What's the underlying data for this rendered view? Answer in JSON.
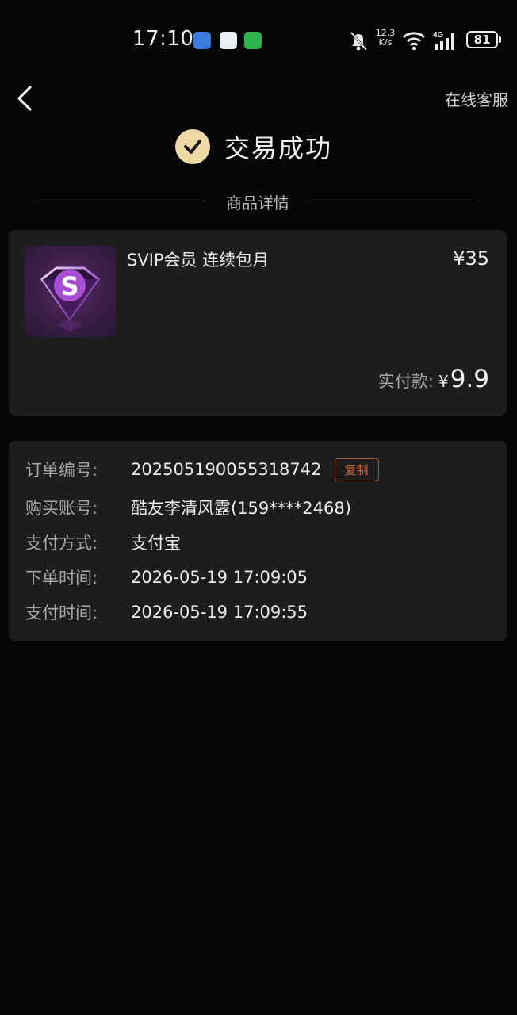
{
  "status_bar": {
    "time": "17:10",
    "net_speed_value": "12.3",
    "net_speed_unit": "K/s",
    "network_type": "4G",
    "battery": "81"
  },
  "header": {
    "service_label": "在线客服",
    "success_text": "交易成功",
    "section_title": "商品详情"
  },
  "product": {
    "name": "SVIP会员 连续包月",
    "price": "¥35",
    "paid_label": "实付款:",
    "paid_currency": "¥",
    "paid_amount": "9.9",
    "thumb_letter": "S"
  },
  "order": {
    "copy_label": "复制",
    "rows": [
      {
        "label": "订单编号:",
        "value": "2025051900553187​42"
      },
      {
        "label": "购买账号:",
        "value": "酷友李清风露(159****2468)"
      },
      {
        "label": "支付方式:",
        "value": "支付宝"
      },
      {
        "label": "下单时间:",
        "value": "2026-05-19 17:09:05"
      },
      {
        "label": "支付时间:",
        "value": "2026-05-19 17:09:55"
      }
    ]
  },
  "colors": {
    "background": "#060606",
    "card": "#1d1d1e",
    "accent_gold": "#efd9a7",
    "copy_accent": "#d0663c"
  },
  "icons": [
    "back-arrow-icon",
    "check-circle-icon",
    "message-app-icon",
    "photo-app-icon",
    "wechat-app-icon",
    "mute-bell-icon",
    "wifi-icon",
    "signal-icon",
    "battery-icon",
    "svip-diamond-icon"
  ]
}
